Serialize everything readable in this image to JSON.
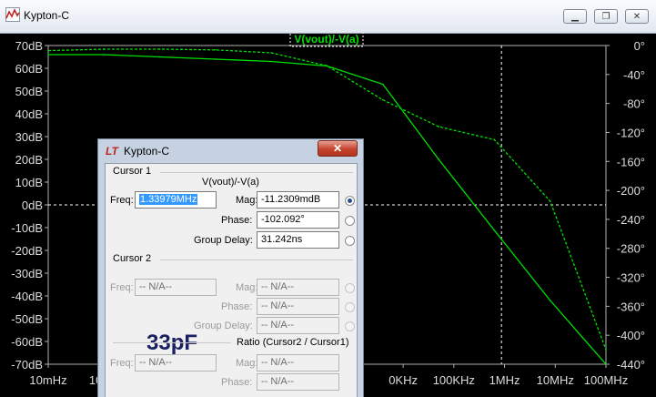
{
  "window": {
    "title": "Kypton-C",
    "minimize_label": "▁",
    "restore_label": "❐",
    "close_label": "✕"
  },
  "plot": {
    "trace_label": "V(vout)/-V(a)",
    "left_axis_ticks": [
      "70dB",
      "60dB",
      "50dB",
      "40dB",
      "30dB",
      "20dB",
      "10dB",
      "0dB",
      "-10dB",
      "-20dB",
      "-30dB",
      "-40dB",
      "-50dB",
      "-60dB",
      "-70dB"
    ],
    "right_axis_ticks": [
      "0°",
      "-40°",
      "-80°",
      "-120°",
      "-160°",
      "-200°",
      "-240°",
      "-280°",
      "-320°",
      "-360°",
      "-400°",
      "-440°"
    ],
    "x_axis_ticks": [
      "10mHz",
      "100",
      "",
      "",
      "",
      "",
      "",
      "0KHz",
      "100KHz",
      "1MHz",
      "10MHz",
      "100MHz"
    ],
    "trace_color": "#00e000",
    "background_color": "#000000"
  },
  "chart_data": {
    "type": "line",
    "x": [
      0.01,
      0.1,
      1,
      10,
      100,
      1000,
      10000,
      100000,
      1000000,
      10000000,
      100000000
    ],
    "series": [
      {
        "name": "V(vout)/-V(a)",
        "axis": "magnitude",
        "values": [
          66,
          66,
          65,
          64,
          63,
          61,
          53,
          20,
          -11.2,
          -42,
          -70
        ]
      },
      {
        "name": "V(vout)/-V(a)",
        "axis": "phase",
        "values": [
          -7,
          -5,
          -5,
          -6,
          -10,
          -28,
          -75,
          -112,
          -130,
          -215,
          -420
        ]
      }
    ],
    "xscale": "log",
    "xlim": [
      0.01,
      100000000
    ],
    "ylim_left": [
      -70,
      70
    ],
    "ylim_right": [
      -440,
      0
    ],
    "cursor_x": 1339790,
    "cursor_y": 0,
    "grid": false
  },
  "dialog": {
    "title": "Kypton-C",
    "logo": "LT",
    "close_label": "✕",
    "cursor1": {
      "group": "Cursor 1",
      "expr": "V(vout)/-V(a)",
      "freq_label": "Freq:",
      "freq_value": "1.33979MHz",
      "mag_label": "Mag:",
      "mag_value": "-11.2309mdB",
      "phase_label": "Phase:",
      "phase_value": "-102.092°",
      "gd_label": "Group Delay:",
      "gd_value": "31.242ns"
    },
    "cursor2": {
      "group": "Cursor 2",
      "freq_label": "Freq:",
      "freq_value": "-- N/A--",
      "mag_label": "Mag:",
      "mag_value": "-- N/A--",
      "phase_label": "Phase:",
      "phase_value": "-- N/A--",
      "gd_label": "Group Delay:",
      "gd_value": "-- N/A--"
    },
    "ratio": {
      "group": "Ratio (Cursor2 / Cursor1)",
      "freq_label": "Freq:",
      "freq_value": "-- N/A--",
      "mag_label": "Mag:",
      "mag_value": "-- N/A--",
      "phase_label": "Phase:",
      "phase_value": "-- N/A--"
    },
    "annotation": "33pF"
  }
}
